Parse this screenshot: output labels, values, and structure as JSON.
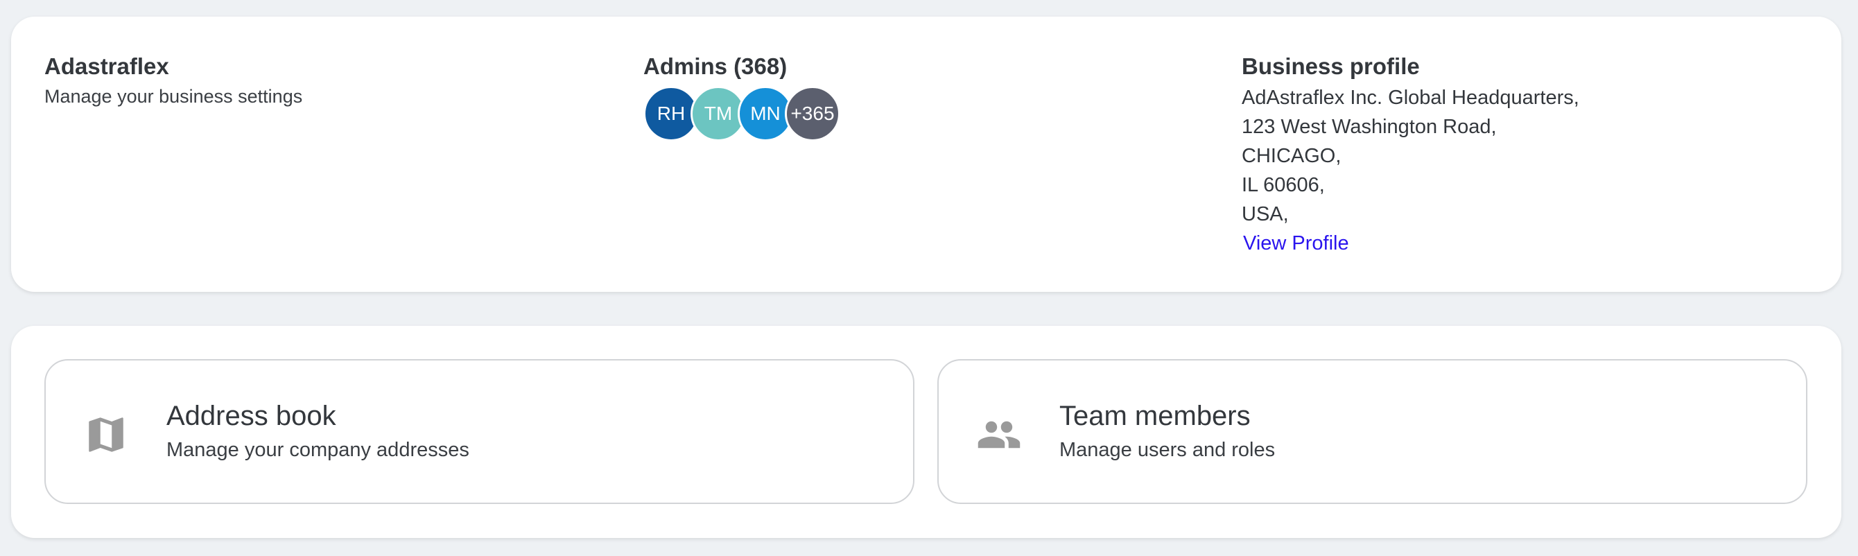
{
  "business": {
    "name": "Adastraflex",
    "description": "Manage your business settings"
  },
  "admins": {
    "title": "Admins (368)",
    "avatars": [
      {
        "initials": "RH",
        "color": "#0f5aa0"
      },
      {
        "initials": "TM",
        "color": "#6cc5c1"
      },
      {
        "initials": "MN",
        "color": "#1590d8"
      },
      {
        "initials": "+365",
        "color": "#5b5f6e"
      }
    ]
  },
  "profile": {
    "title": "Business profile",
    "address_lines": [
      "AdAstraflex Inc. Global Headquarters,",
      "123 West Washington Road,",
      "CHICAGO,",
      "IL 60606,",
      "USA,"
    ],
    "link_label": "View Profile",
    "link_color": "#2a14ee"
  },
  "tiles": [
    {
      "title": "Address book",
      "subtitle": "Manage your company addresses",
      "icon": "map-icon"
    },
    {
      "title": "Team members",
      "subtitle": "Manage users and roles",
      "icon": "people-icon"
    }
  ]
}
